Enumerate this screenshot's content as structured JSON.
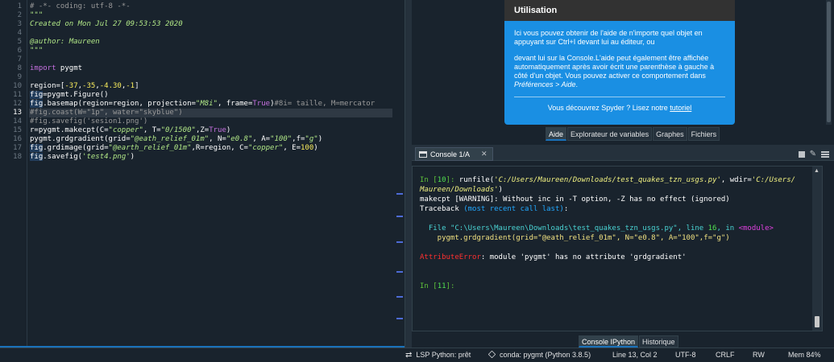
{
  "editor": {
    "line_numbers": [
      "1",
      "2",
      "3",
      "4",
      "5",
      "6",
      "7",
      "8",
      "9",
      "10",
      "11",
      "12",
      "13",
      "14",
      "15",
      "16",
      "17",
      "18"
    ],
    "current_line": "13",
    "code": {
      "l1": "# -*- coding: utf-8 -*-",
      "l2": "\"\"\"",
      "l3": "Created on Mon Jul 27 09:53:53 2020",
      "l5": "@author: Maureen",
      "l6": "\"\"\"",
      "l8_kw": "import",
      "l8_rest": " pygmt",
      "l10_a": "region=[",
      "l10_b": "-37",
      "l10_c": ",",
      "l10_d": "-35",
      "l10_e": ",",
      "l10_f": "-4.30",
      "l10_g": ",",
      "l10_h": "-1",
      "l10_i": "]",
      "l11_fig": "fig",
      "l11_rest": "=pygmt.Figure()",
      "l12_fig": "fig",
      "l12_a": ".basemap(region=region, projection=",
      "l12_b": "\"M8i\"",
      "l12_c": ", frame=",
      "l12_d": "True",
      "l12_e": ")",
      "l12_f": "#8i= taille, M=mercator",
      "l13": "#fig.coast(W=\"1p\", water=\"skyblue\")",
      "l14": "#fig.savefig('sesion1.png')",
      "l15_a": "r=pygmt.makecpt(C=",
      "l15_b": "\"copper\"",
      "l15_c": ", T=",
      "l15_d": "\"0/1500\"",
      "l15_e": ",Z=",
      "l15_f": "True",
      "l15_g": ")",
      "l16_a": "pygmt.grdgradient(grid=",
      "l16_b": "\"@eath_relief_01m\"",
      "l16_c": ", N=",
      "l16_d": "\"e0.8\"",
      "l16_e": ", A=",
      "l16_f": "\"100\"",
      "l16_g": ",f=",
      "l16_h": "\"g\"",
      "l16_i": ")",
      "l17_fig": "fig",
      "l17_a": ".grdimage(grid=",
      "l17_b": "\"@earth_relief_01m\"",
      "l17_c": ",R=region, C=",
      "l17_d": "\"copper\"",
      "l17_e": ", E=",
      "l17_f": "100",
      "l17_g": ")",
      "l18_fig": "fig",
      "l18_a": ".savefig(",
      "l18_b": "'test4.png'",
      "l18_c": ")"
    }
  },
  "help": {
    "title": "Utilisation",
    "para1": "Ici vous pouvez obtenir de l'aide de n'importe quel objet en appuyant sur Ctrl+I devant lui au éditeur, ou",
    "para2_a": "devant lui sur la Console.L'aide peut également être affichée automatiquement après avoir écrit une parenthèse à gauche à côté d'un objet. Vous pouvez activer ce comportement dans ",
    "para2_b": "Préférences > Aide",
    "para2_c": ".",
    "footer_a": "Vous découvrez Spyder ? Lisez notre ",
    "footer_link": "tutoriel",
    "tabs": [
      "Aide",
      "Explorateur de variables",
      "Graphes",
      "Fichiers"
    ]
  },
  "console": {
    "tab_label": "Console 1/A",
    "bottom_tabs": [
      "Console IPython",
      "Historique"
    ],
    "in10_prompt": "In [",
    "in10_num": "10",
    "in10_close": "]: ",
    "runfile_a": "runfile(",
    "runfile_b": "'C:/Users/Maureen/Downloads/test_quakes_tzn_usgs.py'",
    "runfile_c": ", wdir=",
    "runfile_d": "'C:/Users/",
    "runfile_e": "Maureen/Downloads'",
    "runfile_f": ")",
    "warning": "makecpt [WARNING]: Without inc in -T option, -Z has no effect (ignored)",
    "traceback_a": "Traceback ",
    "traceback_b": "(most recent call last)",
    "traceback_c": ":",
    "file_a": "  File ",
    "file_b": "\"C:\\Users\\Maureen\\Downloads\\test_quakes_tzn_usgs.py\"",
    "file_c": ", line ",
    "file_d": "16",
    "file_e": ", in ",
    "file_f": "<module>",
    "src_line": "    pygmt.grdgradient(grid=\"@eath_relief_01m\", N=\"e0.8\", A=\"100\",f=\"g\")",
    "err_a": "AttributeError",
    "err_b": ": module 'pygmt' has no attribute 'grdgradient'",
    "in11_prompt": "In [",
    "in11_num": "11",
    "in11_close": "]: "
  },
  "status": {
    "lsp": "LSP Python: prêt",
    "conda": "conda: pygmt (Python 3.8.5)",
    "position": "Line 13, Col 2",
    "encoding": "UTF-8",
    "eol": "CRLF",
    "mode": "RW",
    "memory": "Mem 84%"
  },
  "icons": {
    "lsp": "swap-arrows-icon",
    "conda": "cube-icon",
    "console_tab": "terminal-icon"
  },
  "colors": {
    "accent": "#1a72bb",
    "help_card": "#1a8fe3",
    "background": "#19232d"
  }
}
